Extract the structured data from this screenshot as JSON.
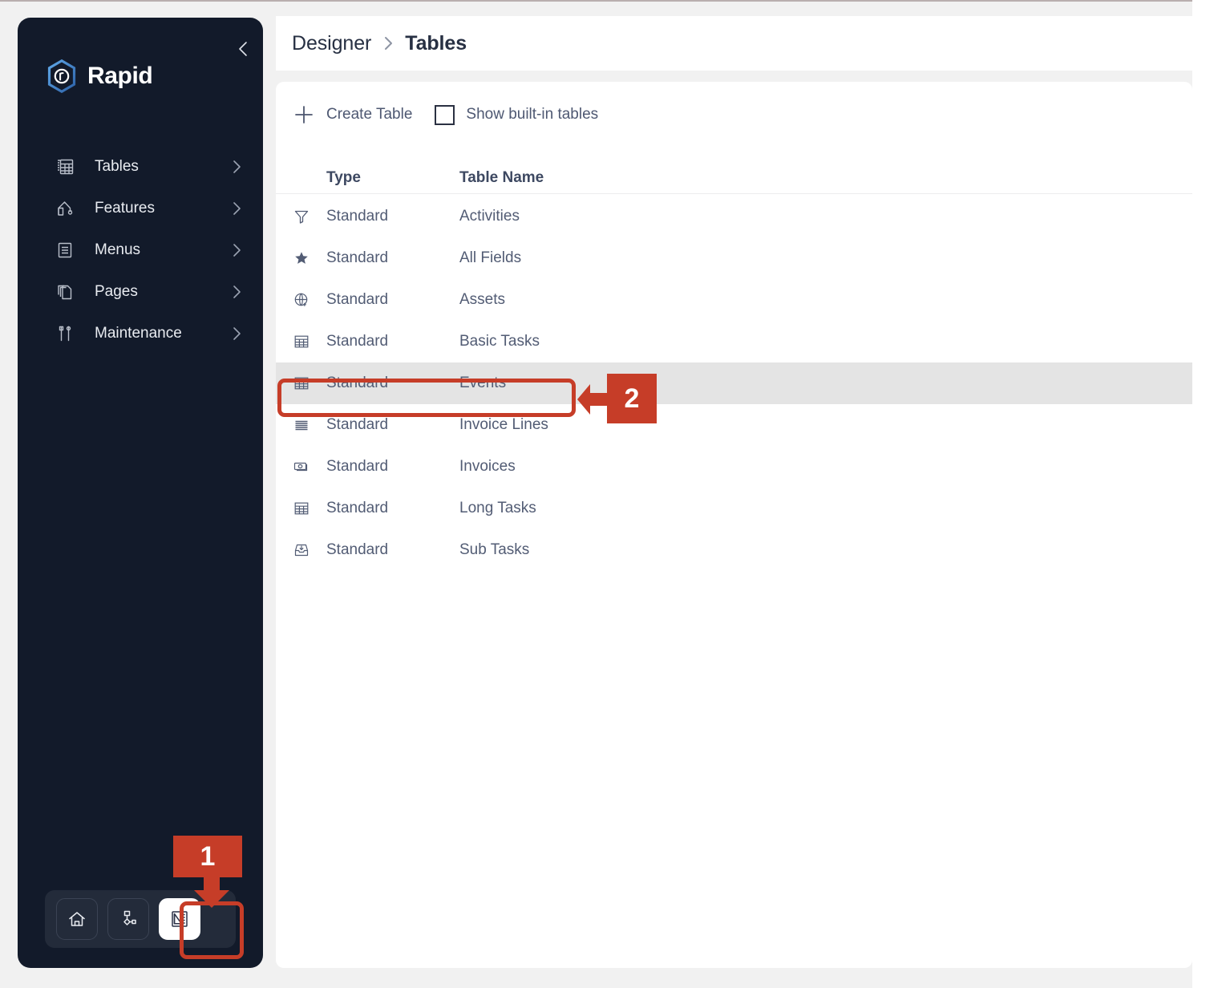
{
  "sidebar": {
    "brand": {
      "name": "Rapid",
      "logo_icon": "rapid-hexagon-logo",
      "accent": "#3b82c4"
    },
    "collapse_icon": "chevron-left-icon",
    "items": [
      {
        "label": "Tables",
        "icon": "table-grid-icon",
        "chevron": "chevron-right-icon"
      },
      {
        "label": "Features",
        "icon": "crane-arm-icon",
        "chevron": "chevron-right-icon"
      },
      {
        "label": "Menus",
        "icon": "document-list-icon",
        "chevron": "chevron-right-icon"
      },
      {
        "label": "Pages",
        "icon": "stacked-pages-icon",
        "chevron": "chevron-right-icon"
      },
      {
        "label": "Maintenance",
        "icon": "tools-icon",
        "chevron": "chevron-right-icon"
      }
    ],
    "dock": [
      {
        "name": "home",
        "icon": "home-icon",
        "active": false
      },
      {
        "name": "workflow",
        "icon": "workflow-icon",
        "active": false
      },
      {
        "name": "designer",
        "icon": "ruler-icon",
        "active": true
      }
    ]
  },
  "breadcrumb": {
    "parent": "Designer",
    "separator": "chevron-right-icon",
    "current": "Tables"
  },
  "toolbar": {
    "create_table_label": "Create Table",
    "create_table_icon": "plus-icon",
    "show_builtin_label": "Show built-in tables",
    "show_builtin_checked": false
  },
  "table": {
    "columns": [
      "Type",
      "Table Name"
    ],
    "rows": [
      {
        "icon": "funnel-icon",
        "type": "Standard",
        "name": "Activities",
        "selected": false
      },
      {
        "icon": "star-icon",
        "type": "Standard",
        "name": "All Fields",
        "selected": false
      },
      {
        "icon": "globe-plus-icon",
        "type": "Standard",
        "name": "Assets",
        "selected": false
      },
      {
        "icon": "table-grid-icon",
        "type": "Standard",
        "name": "Basic Tasks",
        "selected": false
      },
      {
        "icon": "table-grid-icon",
        "type": "Standard",
        "name": "Events",
        "selected": true
      },
      {
        "icon": "list-lines-icon",
        "type": "Standard",
        "name": "Invoice Lines",
        "selected": false
      },
      {
        "icon": "banknote-icon",
        "type": "Standard",
        "name": "Invoices",
        "selected": false
      },
      {
        "icon": "table-grid-icon",
        "type": "Standard",
        "name": "Long Tasks",
        "selected": false
      },
      {
        "icon": "inbox-download-icon",
        "type": "Standard",
        "name": "Sub Tasks",
        "selected": false
      }
    ]
  },
  "annotations": {
    "color": "#c63d28",
    "markers": [
      {
        "number": "1",
        "target": "designer-dock-button"
      },
      {
        "number": "2",
        "target": "events-table-row"
      }
    ]
  }
}
